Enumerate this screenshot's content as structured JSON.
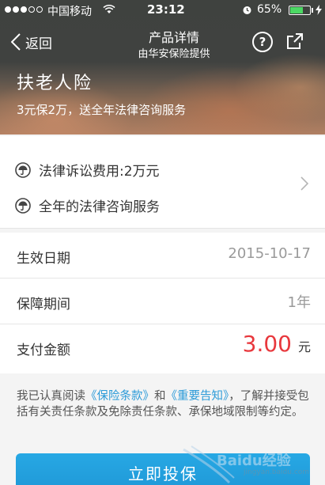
{
  "status_bar": {
    "carrier": "中国移动",
    "time": "23:12",
    "battery_percent": "65%",
    "battery_level": 0.65,
    "signal_bars": 3,
    "icons": [
      "signal-icon",
      "wifi-icon",
      "alarm-icon",
      "battery-icon",
      "charging-bolt-icon"
    ]
  },
  "nav": {
    "back_label": "返回",
    "title": "产品详情",
    "subtitle": "由华安保险提供",
    "help_symbol": "?",
    "icons": [
      "chevron-left-icon",
      "help-icon",
      "share-icon"
    ]
  },
  "hero": {
    "title": "扶老人险",
    "subtitle": "3元保2万，送全年法律咨询服务"
  },
  "benefits": {
    "items": [
      {
        "text": "法律诉讼费用:2万元",
        "icon": "umbrella-icon"
      },
      {
        "text": "全年的法律咨询服务",
        "icon": "umbrella-icon"
      }
    ]
  },
  "info": {
    "effective_date_label": "生效日期",
    "effective_date_value": "2015-10-17",
    "period_label": "保障期间",
    "period_value": "1年",
    "payment_label": "支付金额",
    "payment_value": "3.00",
    "payment_unit": "元"
  },
  "agreement": {
    "prefix": "我已认真阅读",
    "link1": "《保险条款》",
    "and": "和",
    "link2": "《重要告知》",
    "suffix": "，了解并接受包括有关责任条款及免除责任条款、承保地域限制等约定。"
  },
  "buy_button_label": "立即投保",
  "watermark": {
    "text": "Baidu经验",
    "url": "jingyan.baidu.com"
  },
  "colors": {
    "accent_blue": "#1f97d6",
    "price_red": "#e8383d",
    "link_blue": "#2a9ad8"
  }
}
